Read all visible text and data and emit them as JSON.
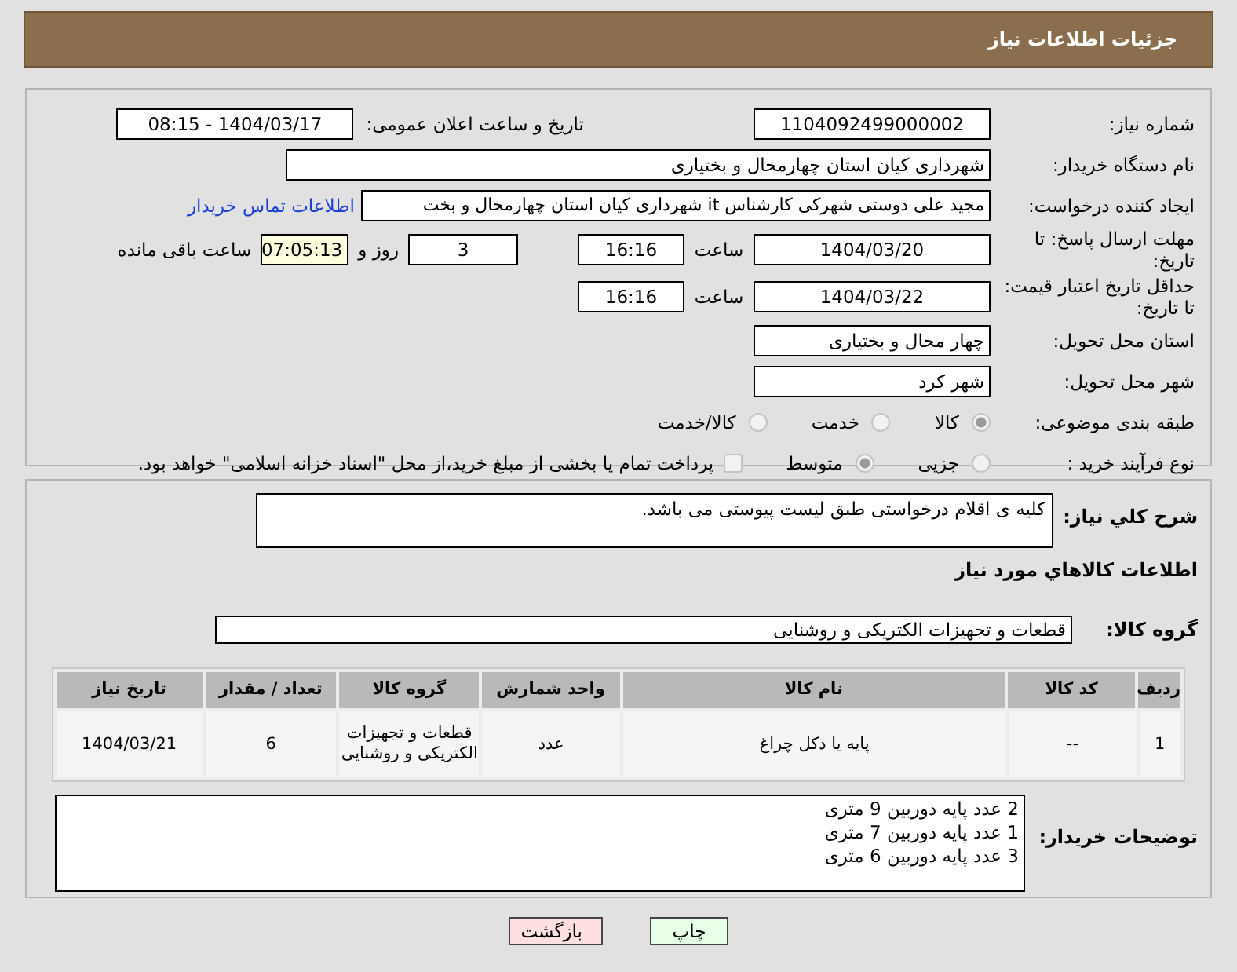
{
  "header": {
    "title": "جزئیات اطلاعات نیاز"
  },
  "need_number": {
    "label": "شماره نیاز:",
    "value": "1104092499000002"
  },
  "announce": {
    "label": "تاریخ و ساعت اعلان عمومی:",
    "value": "1404/03/17 - 08:15"
  },
  "buyer_org": {
    "label": "نام دستگاه خریدار:",
    "value": "شهرداری کیان استان چهارمحال و بختیاری"
  },
  "creator": {
    "label": "ایجاد کننده درخواست:",
    "value": "مجید علی دوستی شهرکی کارشناس it شهرداری کیان استان چهارمحال و بخت",
    "link": "اطلاعات تماس خریدار"
  },
  "reply_deadline": {
    "label": "مهلت ارسال پاسخ: تا تاریخ:",
    "date": "1404/03/20",
    "time_label": "ساعت",
    "time": "16:16",
    "days": "3",
    "days_label": "روز و",
    "remaining": "07:05:13",
    "remaining_label": "ساعت باقی مانده"
  },
  "price_validity": {
    "label": "حداقل تاریخ اعتبار قیمت: تا تاریخ:",
    "date": "1404/03/22",
    "time_label": "ساعت",
    "time": "16:16"
  },
  "province": {
    "label": "استان محل تحویل:",
    "value": "چهار محال و بختیاری"
  },
  "city": {
    "label": "شهر محل تحویل:",
    "value": "شهر کرد"
  },
  "category": {
    "label": "طبقه بندی موضوعی:",
    "options": [
      {
        "label": "کالا",
        "selected": true
      },
      {
        "label": "خدمت",
        "selected": false
      },
      {
        "label": "کالا/خدمت",
        "selected": false
      }
    ]
  },
  "process": {
    "label": "نوع فرآیند خرید :",
    "options": [
      {
        "label": "جزیی",
        "selected": false
      },
      {
        "label": "متوسط",
        "selected": true
      }
    ],
    "treasury": {
      "label": "پرداخت تمام یا بخشی از مبلغ خرید،از محل \"اسناد خزانه اسلامی\" خواهد بود.",
      "checked": false
    }
  },
  "description": {
    "label": "شرح کلي نياز:",
    "value": "کلیه ی اقلام درخواستی طبق لیست پیوستی می باشد."
  },
  "goods_heading": "اطلاعات کالاهاي مورد نياز",
  "goods_group": {
    "label": "گروه کالا:",
    "value": "قطعات و تجهیزات الکتریکی و روشنایی"
  },
  "table": {
    "columns": [
      "ردیف",
      "کد کالا",
      "نام کالا",
      "واحد شمارش",
      "گروه کالا",
      "تعداد / مقدار",
      "تاریخ نیاز"
    ],
    "rows": [
      [
        "1",
        "--",
        "پایه یا دکل چراغ",
        "عدد",
        "قطعات و تجهیزات الکتریکی و روشنایی",
        "6",
        "1404/03/21"
      ]
    ]
  },
  "buyer_notes": {
    "label": "توضیحات خریدار:",
    "lines": [
      "2 عدد پایه دوربین 9 متری",
      "1 عدد پایه دوربین 7 متری",
      "3 عدد پایه دوربین 6 متری"
    ]
  },
  "buttons": [
    {
      "label": "چاپ",
      "kind": "print"
    },
    {
      "label": "بازگشت",
      "kind": "back"
    }
  ]
}
